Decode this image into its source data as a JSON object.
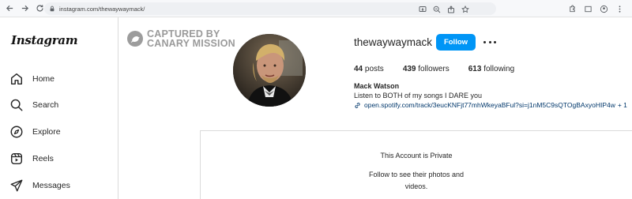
{
  "browser": {
    "url": "instagram.com/thewaywaymack/"
  },
  "sidebar": {
    "logo": "Instagram",
    "items": [
      {
        "label": "Home",
        "icon": "home-icon"
      },
      {
        "label": "Search",
        "icon": "search-icon"
      },
      {
        "label": "Explore",
        "icon": "explore-icon"
      },
      {
        "label": "Reels",
        "icon": "reels-icon"
      },
      {
        "label": "Messages",
        "icon": "messages-icon"
      }
    ]
  },
  "watermark": {
    "line1": "CAPTURED BY",
    "line2": "CANARY MISSION"
  },
  "profile": {
    "username": "thewaywaymack",
    "follow_label": "Follow",
    "posts_count": "44",
    "posts_label": "posts",
    "followers_count": "439",
    "followers_label": "followers",
    "following_count": "613",
    "following_label": "following",
    "full_name": "Mack Watson",
    "bio": "Listen to BOTH of my songs I DARE you",
    "link": "open.spotify.com/track/3eucKNFjt77mhWkeyaBFul?si=j1nM5C9sQTOgBAxyoHIP4w",
    "link_more": "+ 1"
  },
  "private": {
    "title": "This Account is Private",
    "subtitle": "Follow to see their photos and videos."
  },
  "colors": {
    "accent": "#0095f6",
    "link": "#00376b",
    "watermark": "#9a9a9a"
  }
}
